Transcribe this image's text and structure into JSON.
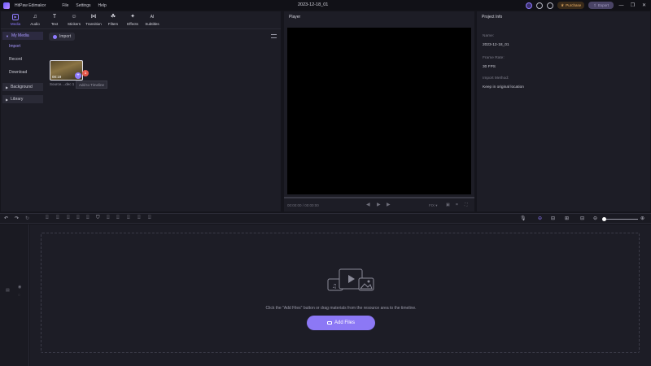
{
  "app": {
    "name": "HitPaw Edimakor",
    "project_title": "2023-12-18_01"
  },
  "menu": [
    "File",
    "Settings",
    "Help"
  ],
  "titlebar": {
    "purchase_label": "Purchase",
    "export_label": "Export",
    "icons": [
      "crown-icon",
      "download-icon",
      "smile-icon",
      "window-min-icon",
      "window-max-icon",
      "close-icon"
    ]
  },
  "toolbar": {
    "tabs": [
      {
        "label": "Media",
        "icon": "media-icon",
        "glyph": "▭"
      },
      {
        "label": "Audio",
        "icon": "music-icon",
        "glyph": "♫"
      },
      {
        "label": "Text",
        "icon": "text-icon",
        "glyph": "T"
      },
      {
        "label": "Stickers",
        "icon": "sticker-icon",
        "glyph": "☺"
      },
      {
        "label": "Transition",
        "icon": "transition-icon",
        "glyph": "⋈"
      },
      {
        "label": "Filters",
        "icon": "filter-icon",
        "glyph": "☘"
      },
      {
        "label": "Effects",
        "icon": "effects-icon",
        "glyph": "✦"
      },
      {
        "label": "Subtitles",
        "icon": "subtitles-icon",
        "glyph": "AI"
      }
    ]
  },
  "sidebar": {
    "my_media": "My Media",
    "items": [
      "Import",
      "Record",
      "Download"
    ],
    "background": "Background",
    "library": "Library"
  },
  "media": {
    "import_label": "Import",
    "clip": {
      "duration": "00:19",
      "name": "Source....dec 1",
      "badge": "1"
    },
    "tooltip": "Add to Timeline"
  },
  "player": {
    "title": "Player",
    "time": "00:00:00 / 00:00:00",
    "fit": "FIX ▾"
  },
  "info": {
    "title": "Project Info",
    "name_label": "Name:",
    "name_value": "2023-12-18_01",
    "frame_rate_label": "Frame Rate:",
    "frame_rate_value": "30 FPS",
    "import_method_label": "Import Method:",
    "import_method_value": "Keep in original location"
  },
  "timeline": {
    "hint": "Click the \"Add Files\" button or drag materials from the resource area to the timeline.",
    "add_files_label": "Add Files"
  },
  "colors": {
    "accent": "#8c78f5",
    "panel": "#1d1d26",
    "background": "#15151c"
  }
}
